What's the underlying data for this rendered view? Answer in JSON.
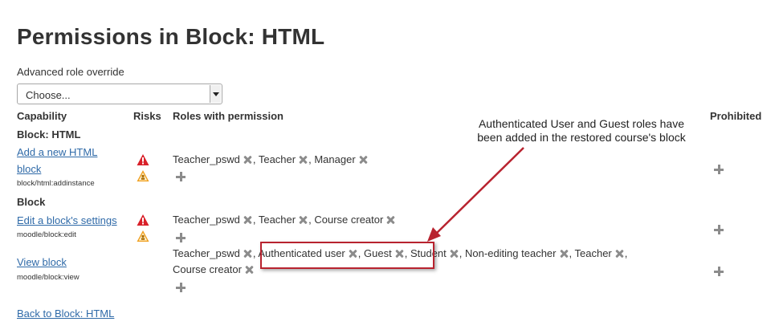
{
  "page": {
    "title": "Permissions in Block: HTML",
    "override_label": "Advanced role override",
    "override_select": "Choose..."
  },
  "table": {
    "headers": {
      "capability": "Capability",
      "risks": "Risks",
      "roles": "Roles with permission",
      "prohibited": "Prohibited"
    },
    "sections": [
      {
        "label": "Block: HTML"
      },
      {
        "label": "Block"
      }
    ],
    "rows": [
      {
        "capability_line1": "Add a new HTML",
        "capability_line2": "block",
        "capability_name": "block/html:addinstance",
        "roles": [
          "Teacher_pswd",
          "Teacher",
          "Manager"
        ]
      },
      {
        "capability": "Edit a block's settings",
        "capability_name": "moodle/block:edit",
        "roles": [
          "Teacher_pswd",
          "Teacher",
          "Course creator"
        ]
      },
      {
        "capability": "View block",
        "capability_name": "moodle/block:view",
        "roles": [
          "Teacher_pswd",
          "Authenticated user",
          "Guest",
          "Student",
          "Non-editing teacher",
          "Teacher",
          "Course creator"
        ]
      }
    ],
    "separator": ","
  },
  "callout": {
    "text": "Authenticated User and Guest roles have been added in the restored course's block"
  },
  "back_link": "Back to Block: HTML",
  "colors": {
    "link": "#2f6aa8",
    "callout_red": "#b8232f",
    "risk_red": "#d9212a",
    "risk_orange": "#f0a020",
    "icon_gray": "#8c8c8c"
  },
  "icons": {
    "risk_xss": "warning-triangle-icon",
    "risk_spam": "warning-person-icon",
    "remove": "x-icon",
    "add": "plus-icon"
  }
}
